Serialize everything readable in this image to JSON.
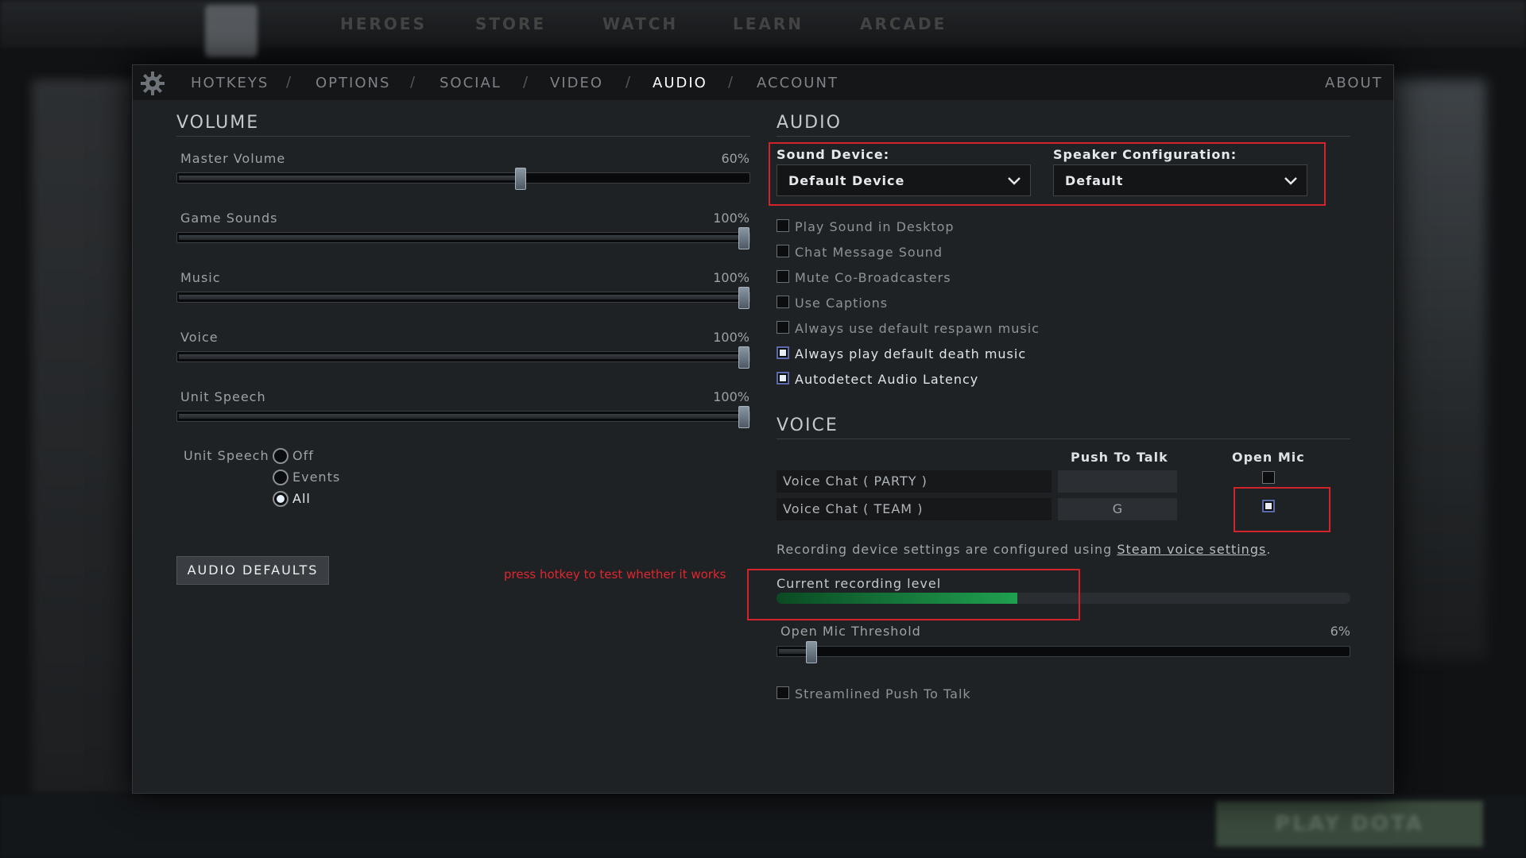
{
  "background": {
    "nav_items": [
      "HEROES",
      "STORE",
      "WATCH",
      "LEARN",
      "ARCADE"
    ],
    "play_button": "PLAY DOTA"
  },
  "tabs": [
    {
      "label": "HOTKEYS",
      "active": false
    },
    {
      "label": "OPTIONS",
      "active": false
    },
    {
      "label": "SOCIAL",
      "active": false
    },
    {
      "label": "VIDEO",
      "active": false
    },
    {
      "label": "AUDIO",
      "active": true
    },
    {
      "label": "ACCOUNT",
      "active": false
    }
  ],
  "tab_separator": "/",
  "about_label": "ABOUT",
  "volume": {
    "title": "VOLUME",
    "sliders": [
      {
        "label": "Master Volume",
        "value": "60%",
        "fraction": 0.6
      },
      {
        "label": "Game Sounds",
        "value": "100%",
        "fraction": 1.0
      },
      {
        "label": "Music",
        "value": "100%",
        "fraction": 1.0
      },
      {
        "label": "Voice",
        "value": "100%",
        "fraction": 1.0
      },
      {
        "label": "Unit Speech",
        "value": "100%",
        "fraction": 1.0
      }
    ],
    "unit_speech_label": "Unit Speech",
    "unit_speech_options": [
      {
        "label": "Off",
        "selected": false
      },
      {
        "label": "Events",
        "selected": false
      },
      {
        "label": "All",
        "selected": true
      }
    ],
    "defaults_button": "AUDIO DEFAULTS"
  },
  "audio": {
    "title": "AUDIO",
    "sound_device_label": "Sound Device:",
    "sound_device_value": "Default Device",
    "speaker_config_label": "Speaker Configuration:",
    "speaker_config_value": "Default",
    "checkboxes": [
      {
        "label": "Play Sound in Desktop",
        "checked": false
      },
      {
        "label": "Chat Message Sound",
        "checked": false
      },
      {
        "label": "Mute Co-Broadcasters",
        "checked": false
      },
      {
        "label": "Use Captions",
        "checked": false
      },
      {
        "label": "Always use default respawn music",
        "checked": false
      },
      {
        "label": "Always play default death music",
        "checked": true
      },
      {
        "label": "Autodetect Audio Latency",
        "checked": true
      }
    ]
  },
  "voice": {
    "title": "VOICE",
    "push_to_talk_header": "Push To Talk",
    "open_mic_header": "Open Mic",
    "rows": [
      {
        "label": "Voice Chat ( PARTY )",
        "key": "",
        "open_mic": false
      },
      {
        "label": "Voice Chat ( TEAM )",
        "key": "G",
        "open_mic": true
      }
    ],
    "recording_info_prefix": "Recording device settings are configured using ",
    "recording_info_link": "Steam voice settings",
    "recording_info_suffix": ".",
    "recording_level_label": "Current recording level",
    "recording_level_fraction": 0.42,
    "threshold_label": "Open Mic Threshold",
    "threshold_value": "6%",
    "threshold_fraction": 0.06,
    "streamlined_label": "Streamlined Push To Talk",
    "streamlined_checked": false
  },
  "annotation": {
    "note": "press hotkey to test whether it works",
    "color": "#d2232a"
  }
}
